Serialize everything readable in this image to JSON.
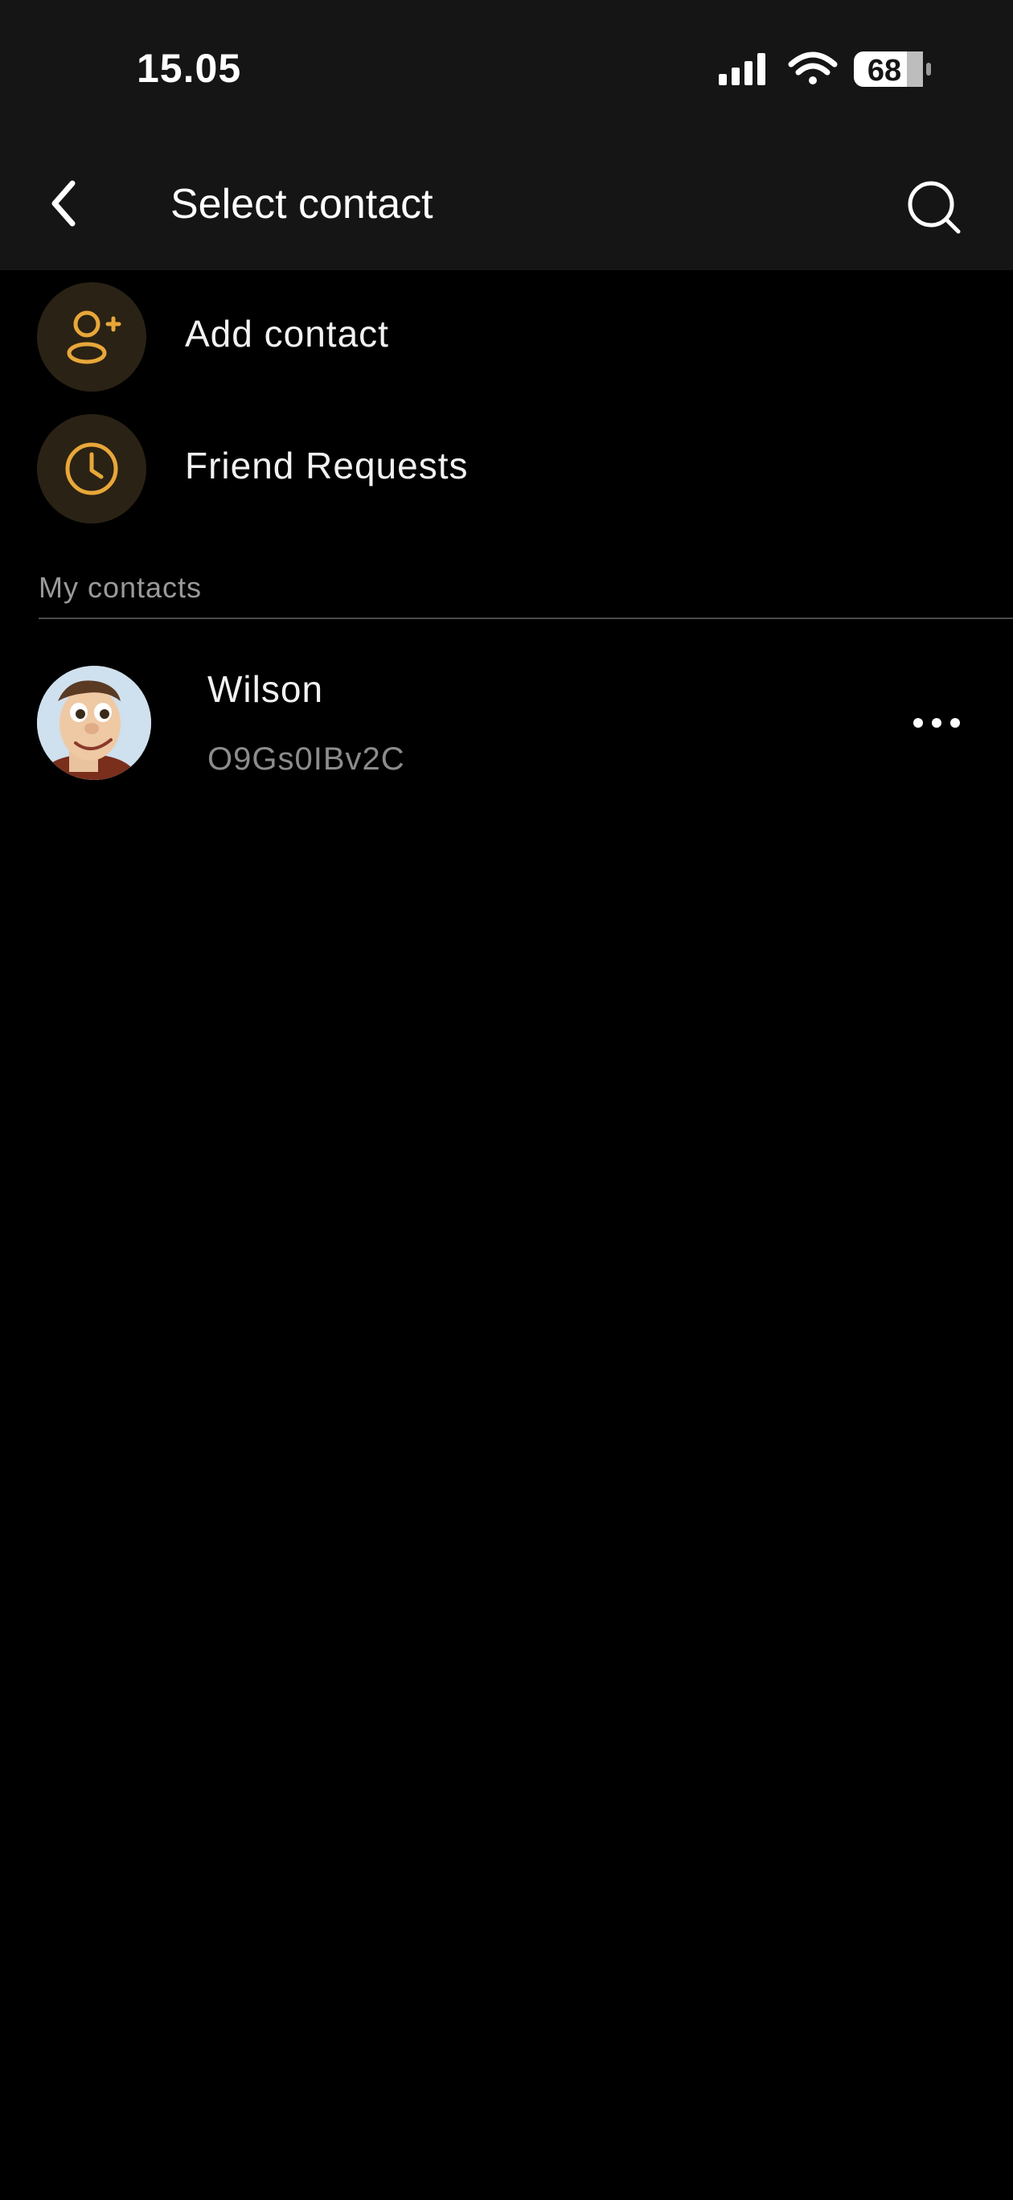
{
  "status": {
    "time": "15.05",
    "battery": "68"
  },
  "header": {
    "title": "Select contact"
  },
  "actions": [
    {
      "label": "Add contact",
      "icon": "add-user-icon"
    },
    {
      "label": "Friend Requests",
      "icon": "clock-icon"
    }
  ],
  "section": {
    "label": "My contacts"
  },
  "contacts": [
    {
      "name": "Wilson",
      "id": "O9Gs0IBv2C"
    }
  ],
  "colors": {
    "accent": "#E8A73A",
    "background": "#000000",
    "bar": "#151515"
  }
}
